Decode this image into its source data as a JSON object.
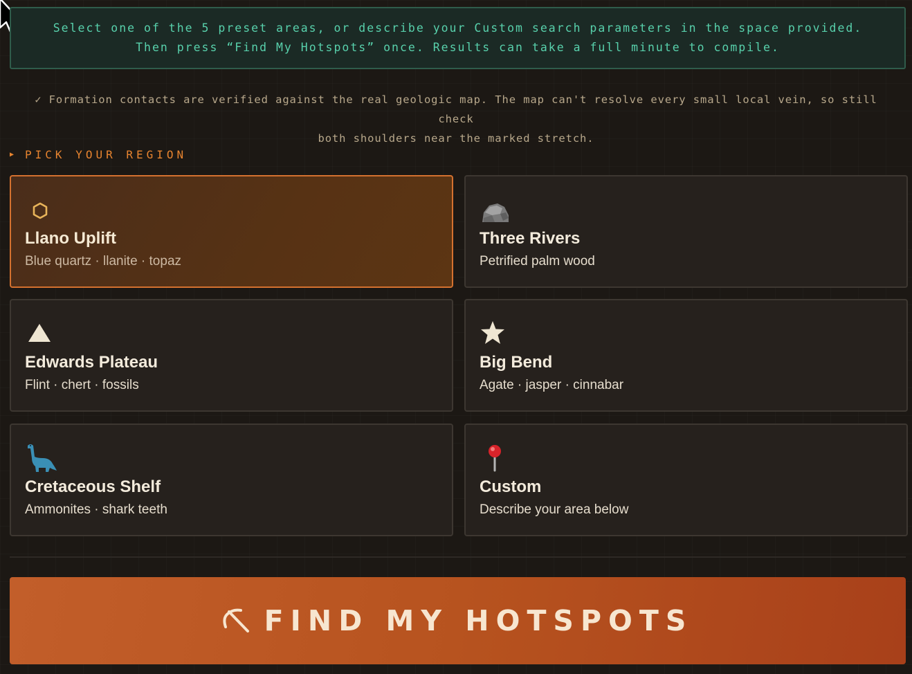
{
  "instructions": {
    "line1": "Select one of the 5 preset areas, or describe your Custom search parameters in the space provided.",
    "line2": "Then press “Find My Hotspots” once. Results can take a full minute to compile."
  },
  "note": {
    "line1": "✓ Formation contacts are verified against the real geologic map. The map can't resolve every small local vein, so still check",
    "line2": "both shoulders near the marked stretch."
  },
  "section": {
    "marker": "▶",
    "label": "PICK YOUR REGION"
  },
  "regions": [
    {
      "icon": "hexagon-icon",
      "title": "Llano Uplift",
      "subtitle": "Blue quartz · llanite · topaz",
      "selected": true
    },
    {
      "icon": "rock-icon",
      "title": "Three Rivers",
      "subtitle": "Petrified palm wood",
      "selected": false
    },
    {
      "icon": "triangle-icon",
      "title": "Edwards Plateau",
      "subtitle": "Flint · chert · fossils",
      "selected": false
    },
    {
      "icon": "star-icon",
      "title": "Big Bend",
      "subtitle": "Agate · jasper · cinnabar",
      "selected": false
    },
    {
      "icon": "dinosaur-icon",
      "title": "Cretaceous Shelf",
      "subtitle": "Ammonites · shark teeth",
      "selected": false
    },
    {
      "icon": "pin-icon",
      "title": "Custom",
      "subtitle": "Describe your area below",
      "selected": false
    }
  ],
  "cta": {
    "icon": "pickaxe-icon",
    "label": "FIND MY HOTSPOTS"
  },
  "colors": {
    "accent": "#e8842f",
    "info_text": "#58d1ac",
    "selected_border": "#d4712f",
    "button": "#b7531f"
  }
}
